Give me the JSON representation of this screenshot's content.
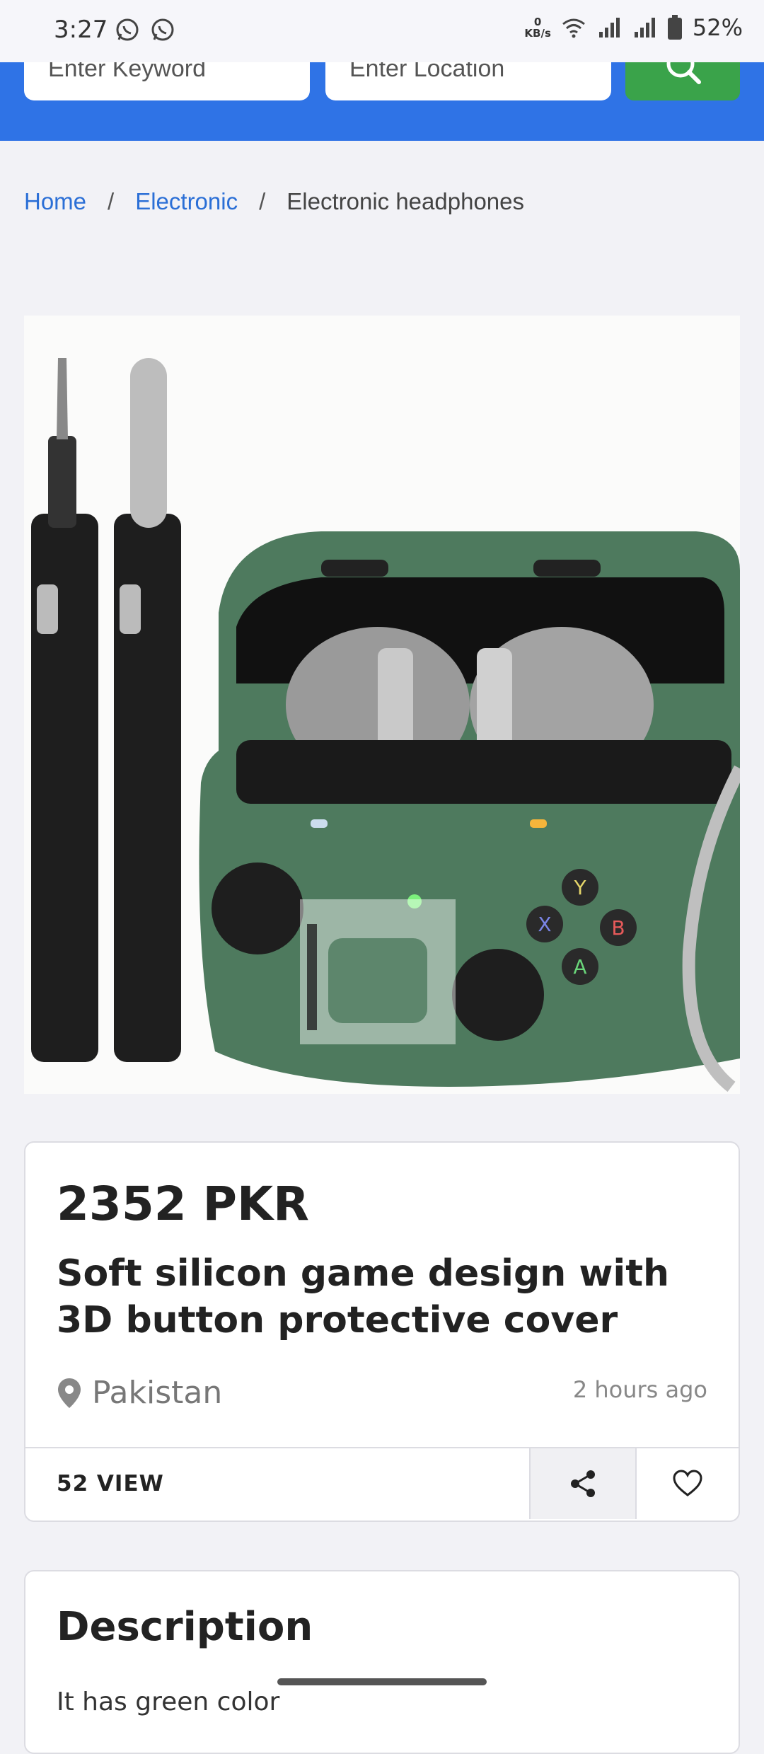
{
  "status_bar": {
    "time": "3:27",
    "net_value": "0",
    "net_unit": "KB/s",
    "battery": "52%",
    "icons": [
      "whatsapp-icon",
      "whatsapp-business-icon",
      "wifi-icon",
      "signal-icon",
      "signal-icon",
      "battery-icon"
    ]
  },
  "search": {
    "keyword_placeholder": "Enter Keyword",
    "location_placeholder": "Enter Location",
    "button_icon": "search-icon"
  },
  "breadcrumb": {
    "home": "Home",
    "category": "Electronic",
    "current": "Electronic headphones",
    "separator": "/"
  },
  "product": {
    "price": "2352 PKR",
    "title": "Soft silicon game design with 3D button protective cover",
    "location": "Pakistan",
    "posted": "2 hours ago",
    "views": "52 VIEW"
  },
  "description": {
    "heading": "Description",
    "text": "It has green color"
  },
  "colors": {
    "header_blue": "#2f73e6",
    "search_green": "#3aa34a",
    "link_blue": "#2b6fd6",
    "case_green": "#4e7a5e"
  }
}
